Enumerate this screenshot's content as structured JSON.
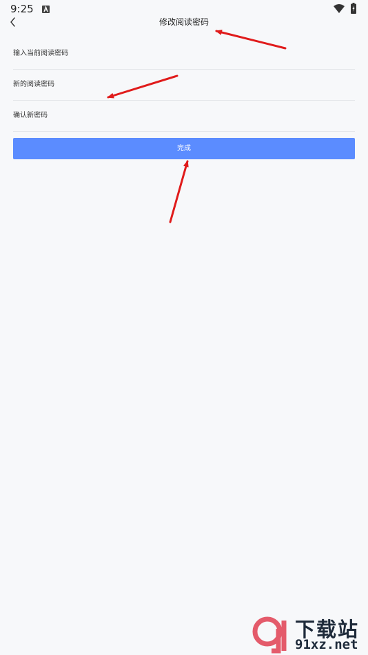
{
  "status_bar": {
    "time": "9:25"
  },
  "header": {
    "title": "修改阅读密码"
  },
  "form": {
    "current_password_placeholder": "输入当前阅读密码",
    "new_password_placeholder": "新的阅读密码",
    "confirm_password_placeholder": "确认新密码",
    "submit_label": "完成"
  },
  "watermark": {
    "title": "下载站",
    "domain": "91xz.net"
  },
  "colors": {
    "accent": "#5b8cff",
    "background": "#f7f8fa",
    "annotation": "#e01b1b"
  }
}
